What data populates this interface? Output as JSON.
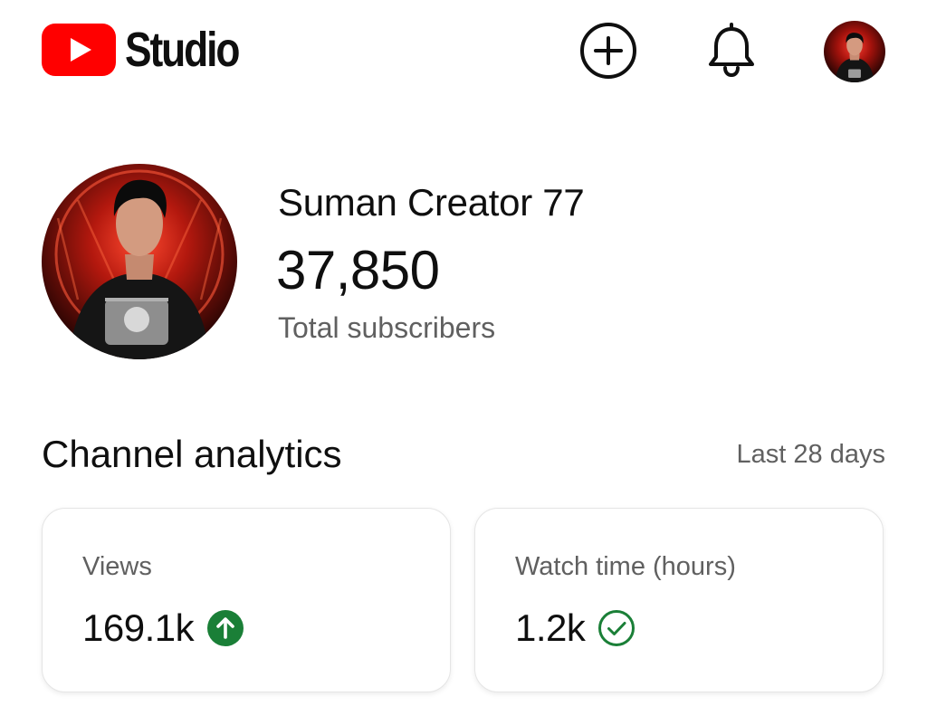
{
  "header": {
    "brand": "Studio",
    "actions": {
      "create_icon": "plus-circle-icon",
      "notifications_icon": "bell-icon",
      "account_icon": "avatar"
    }
  },
  "channel": {
    "name": "Suman Creator 77",
    "subscriber_count": "37,850",
    "subscriber_label": "Total subscribers"
  },
  "analytics": {
    "title": "Channel analytics",
    "period": "Last 28 days",
    "cards": [
      {
        "label": "Views",
        "value": "169.1k",
        "status_icon": "arrow-up-circle-icon",
        "status_color": "#1a7f37"
      },
      {
        "label": "Watch time (hours)",
        "value": "1.2k",
        "status_icon": "check-circle-icon",
        "status_color": "#1a7f37"
      }
    ]
  },
  "colors": {
    "brand_red": "#ff0000",
    "text_primary": "#0f0f0f",
    "text_secondary": "#606060",
    "card_border": "#e5e5e5",
    "positive_green": "#1a7f37"
  }
}
